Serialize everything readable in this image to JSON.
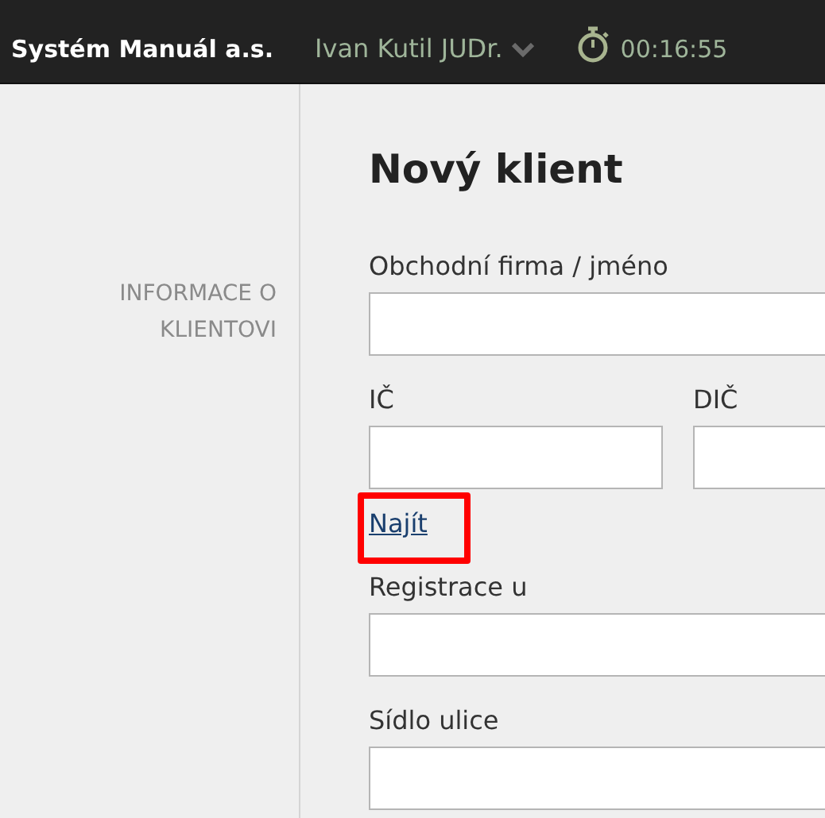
{
  "header": {
    "brand": "Systém Manuál a.s.",
    "user": "Ivan Kutil JUDr.",
    "timer": "00:16:55"
  },
  "sidebar": {
    "section_label": "INFORMACE O KLIENTOVI"
  },
  "form": {
    "title": "Nový klient",
    "rows": [
      {
        "kind": "field",
        "label": "Obchodní firma / jméno"
      },
      {
        "kind": "pair",
        "fields": [
          {
            "label": "IČ"
          },
          {
            "label": "DIČ"
          }
        ]
      },
      {
        "kind": "link",
        "text": "Najít",
        "highlighted": true
      },
      {
        "kind": "field",
        "label": "Registrace u"
      },
      {
        "kind": "field",
        "label": "Sídlo ulice"
      }
    ]
  }
}
